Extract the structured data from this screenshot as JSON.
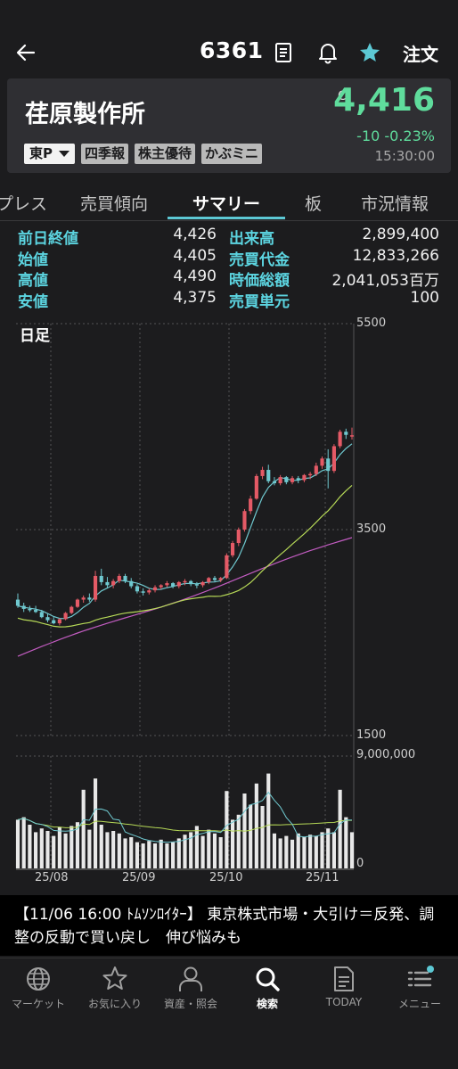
{
  "header": {
    "code": "6361",
    "order_label": "注文",
    "icons": [
      "back-arrow-icon",
      "document-icon",
      "bell-icon",
      "star-icon"
    ],
    "star_color": "#5cc8d4"
  },
  "stock": {
    "name": "荏原製作所",
    "market_select": "東P",
    "tags": [
      "四季報",
      "株主優待",
      "かぶミニ"
    ],
    "price_flag": "C",
    "price": "4,416",
    "change": "-10  -0.23%",
    "time": "15:30:00",
    "price_color": "#5fdc9c"
  },
  "tabs": [
    {
      "label": "プレス"
    },
    {
      "label": "売買傾向"
    },
    {
      "label": "サマリー",
      "active": true
    },
    {
      "label": "板"
    },
    {
      "label": "市況情報"
    }
  ],
  "summary": [
    {
      "label": "前日終値",
      "value": "4,426",
      "label2": "出来高",
      "value2": "2,899,400"
    },
    {
      "label": "始値",
      "value": "4,405",
      "label2": "売買代金",
      "value2": "12,833,266"
    },
    {
      "label": "高値",
      "value": "4,490",
      "label2": "時価総額",
      "value2": "2,041,053百万"
    },
    {
      "label": "安値",
      "value": "4,375",
      "label2": "売買単元",
      "value2": "100"
    }
  ],
  "chart_data": {
    "type": "candlestick",
    "period_label": "日足",
    "price_axis_labels": [
      "5500",
      "3500",
      "1500"
    ],
    "ylim": [
      1500,
      5500
    ],
    "volume_axis_labels": [
      "9,000,000",
      "0"
    ],
    "volume_ylim": [
      0,
      9000000
    ],
    "x_tick_labels": [
      "25/08",
      "25/09",
      "25/10",
      "25/11"
    ],
    "grid": true,
    "up_color": "#e45a66",
    "down_color": "#6fc8cf",
    "ma_colors": {
      "short": "#6fc8cf",
      "mid": "#b6d957",
      "long": "#c25cc1"
    },
    "candles": [
      [
        2820,
        2880,
        2740,
        2760
      ],
      [
        2760,
        2790,
        2700,
        2730
      ],
      [
        2730,
        2760,
        2700,
        2720
      ],
      [
        2720,
        2760,
        2690,
        2700
      ],
      [
        2700,
        2720,
        2640,
        2650
      ],
      [
        2650,
        2680,
        2600,
        2620
      ],
      [
        2620,
        2650,
        2580,
        2590
      ],
      [
        2590,
        2640,
        2570,
        2630
      ],
      [
        2630,
        2700,
        2620,
        2690
      ],
      [
        2690,
        2760,
        2680,
        2750
      ],
      [
        2750,
        2830,
        2740,
        2820
      ],
      [
        2820,
        2860,
        2790,
        2840
      ],
      [
        2840,
        2880,
        2800,
        2820
      ],
      [
        2820,
        3100,
        2800,
        3050
      ],
      [
        3050,
        3120,
        2960,
        2990
      ],
      [
        2990,
        3040,
        2930,
        2960
      ],
      [
        2960,
        3020,
        2930,
        3000
      ],
      [
        3000,
        3070,
        2980,
        3050
      ],
      [
        3050,
        3070,
        2980,
        3000
      ],
      [
        3000,
        3030,
        2930,
        2950
      ],
      [
        2950,
        2970,
        2880,
        2900
      ],
      [
        2900,
        2930,
        2860,
        2890
      ],
      [
        2890,
        2930,
        2870,
        2910
      ],
      [
        2910,
        2960,
        2890,
        2940
      ],
      [
        2940,
        2970,
        2920,
        2960
      ],
      [
        2960,
        3000,
        2940,
        2980
      ],
      [
        2980,
        2990,
        2930,
        2950
      ],
      [
        2950,
        3000,
        2930,
        2990
      ],
      [
        2990,
        3020,
        2960,
        3000
      ],
      [
        3000,
        3010,
        2950,
        2970
      ],
      [
        2970,
        2990,
        2930,
        2960
      ],
      [
        2960,
        3000,
        2940,
        2990
      ],
      [
        2990,
        3040,
        2970,
        3030
      ],
      [
        3030,
        3050,
        2990,
        3010
      ],
      [
        3010,
        3040,
        2990,
        3030
      ],
      [
        3030,
        3270,
        3020,
        3250
      ],
      [
        3250,
        3390,
        3230,
        3370
      ],
      [
        3370,
        3520,
        3340,
        3500
      ],
      [
        3500,
        3700,
        3480,
        3680
      ],
      [
        3680,
        3830,
        3650,
        3800
      ],
      [
        3800,
        4040,
        3790,
        4020
      ],
      [
        4020,
        4110,
        3990,
        4080
      ],
      [
        4080,
        4130,
        3950,
        3970
      ],
      [
        3970,
        4010,
        3930,
        3950
      ],
      [
        3950,
        4030,
        3930,
        4010
      ],
      [
        4010,
        4020,
        3940,
        3960
      ],
      [
        3960,
        4020,
        3940,
        4000
      ],
      [
        4000,
        4020,
        3950,
        3980
      ],
      [
        3980,
        4040,
        3960,
        4030
      ],
      [
        4030,
        4060,
        3990,
        4040
      ],
      [
        4040,
        4150,
        4020,
        4120
      ],
      [
        4120,
        4210,
        4090,
        4190
      ],
      [
        4190,
        4280,
        3900,
        4070
      ],
      [
        4070,
        4330,
        4050,
        4310
      ],
      [
        4310,
        4470,
        4290,
        4450
      ],
      [
        4450,
        4480,
        4380,
        4420
      ],
      [
        4405,
        4490,
        4375,
        4416
      ]
    ],
    "volumes": [
      3900000,
      4100000,
      3500000,
      2900000,
      3200000,
      3000000,
      2600000,
      3300000,
      2800000,
      3400000,
      3700000,
      6300000,
      3100000,
      7200000,
      3500000,
      2900000,
      3000000,
      2800000,
      2400000,
      2500000,
      2100000,
      2000000,
      2200000,
      2000000,
      2300000,
      2000000,
      2100000,
      2400000,
      2700000,
      2900000,
      3400000,
      2600000,
      3100000,
      2800000,
      2500000,
      6200000,
      3900000,
      4300000,
      6000000,
      5100000,
      6800000,
      5000000,
      7600000,
      2800000,
      2400000,
      2600000,
      2300000,
      2800000,
      2500000,
      2700000,
      2600000,
      2900000,
      3200000,
      2900000,
      6300000,
      4100000,
      2899400
    ]
  },
  "news": {
    "text": "【11/06 16:00 ﾄﾑｿﾝﾛｲﾀｰ】 東京株式市場・大引け＝反発、調整の反動で買い戻し　伸び悩みも"
  },
  "nav": [
    {
      "label": "マーケット",
      "icon": "globe-icon"
    },
    {
      "label": "お気に入り",
      "icon": "star-outline-icon"
    },
    {
      "label": "資産・照会",
      "icon": "person-icon"
    },
    {
      "label": "検索",
      "icon": "search-icon",
      "active": true
    },
    {
      "label": "TODAY",
      "icon": "news-icon"
    },
    {
      "label": "メニュー",
      "icon": "menu-icon",
      "badge_color": "#5cc8d4"
    }
  ]
}
